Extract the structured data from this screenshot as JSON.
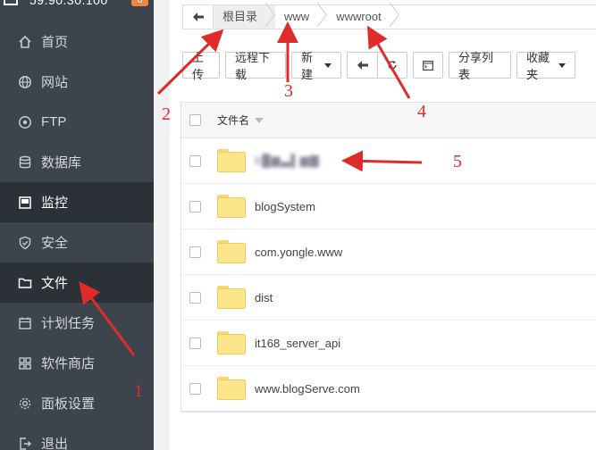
{
  "header": {
    "ip": "59.90.30.100",
    "badge": "0"
  },
  "sidebar": {
    "items": [
      {
        "label": "首页",
        "icon": "home-icon"
      },
      {
        "label": "网站",
        "icon": "globe-icon"
      },
      {
        "label": "FTP",
        "icon": "ftp-icon"
      },
      {
        "label": "数据库",
        "icon": "database-icon"
      },
      {
        "label": "监控",
        "icon": "monitor-icon"
      },
      {
        "label": "安全",
        "icon": "shield-icon"
      },
      {
        "label": "文件",
        "icon": "folder-icon"
      },
      {
        "label": "计划任务",
        "icon": "calendar-icon"
      },
      {
        "label": "软件商店",
        "icon": "grid-icon"
      },
      {
        "label": "面板设置",
        "icon": "gear-icon"
      },
      {
        "label": "退出",
        "icon": "logout-icon"
      }
    ]
  },
  "breadcrumb": {
    "back_icon": "arrow-left-icon",
    "items": [
      "根目录",
      "www",
      "wwwroot"
    ]
  },
  "toolbar": {
    "upload": "上传",
    "remote_download": "远程下载",
    "new": "新建",
    "back_icon": "arrow-left-icon",
    "refresh_icon": "refresh-icon",
    "terminal_icon": "terminal-icon",
    "share_list": "分享列表",
    "favorites": "收藏夹"
  },
  "table": {
    "header": "文件名",
    "rows": [
      {
        "name": "b█▆▃▌▆▇",
        "blurred": true
      },
      {
        "name": "blogSystem"
      },
      {
        "name": "com.yongle.www"
      },
      {
        "name": "dist"
      },
      {
        "name": "it168_server_api"
      },
      {
        "name": "www.blogServe.com"
      }
    ]
  },
  "annotations": {
    "numbers": [
      "1",
      "2",
      "3",
      "4",
      "5"
    ],
    "color": "#e02b2b"
  },
  "colors": {
    "sidebar_bg": "#3c444d",
    "sidebar_active": "#2b3137",
    "badge": "#f0883a",
    "folder": "#fde58c"
  }
}
